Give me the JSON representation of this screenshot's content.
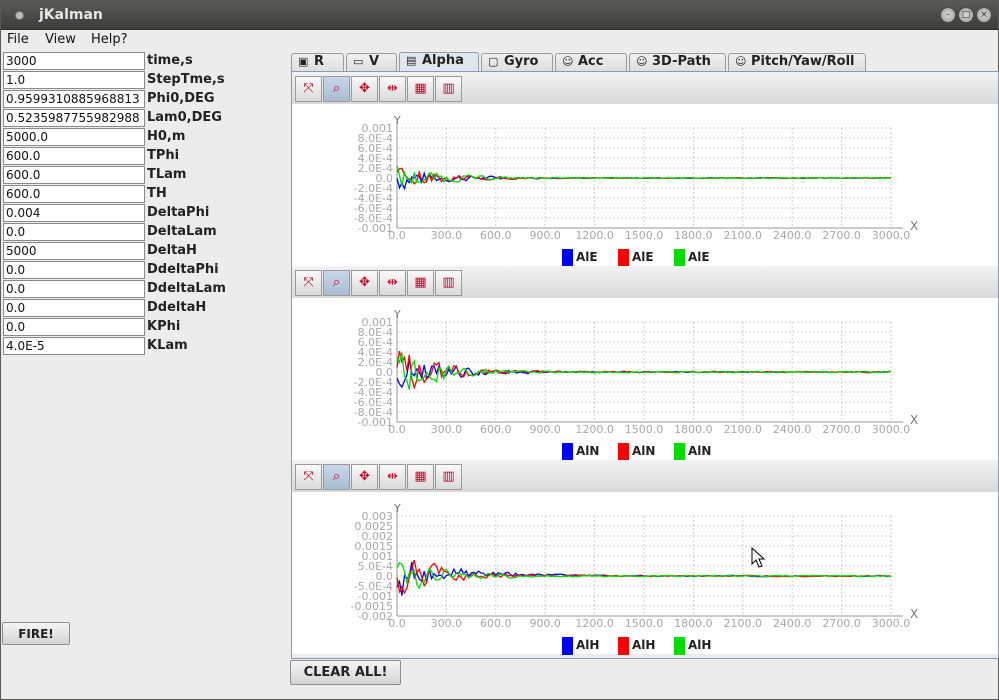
{
  "window": {
    "title": "jKalman"
  },
  "menu": [
    "File",
    "View",
    "Help?"
  ],
  "fields": [
    {
      "value": "3000",
      "label": "time,s"
    },
    {
      "value": "1.0",
      "label": "StepTme,s"
    },
    {
      "value": "0.9599310885968813",
      "label": "Phi0,DEG"
    },
    {
      "value": "0.5235987755982988",
      "label": "Lam0,DEG"
    },
    {
      "value": "5000.0",
      "label": "H0,m"
    },
    {
      "value": "600.0",
      "label": "TPhi"
    },
    {
      "value": "600.0",
      "label": "TLam"
    },
    {
      "value": "600.0",
      "label": "TH"
    },
    {
      "value": "0.004",
      "label": "DeltaPhi"
    },
    {
      "value": "0.0",
      "label": "DeltaLam"
    },
    {
      "value": "5000",
      "label": "DeltaH"
    },
    {
      "value": "0.0",
      "label": "DdeltaPhi"
    },
    {
      "value": "0.0",
      "label": "DdeltaLam"
    },
    {
      "value": "0.0",
      "label": "DdeltaH"
    },
    {
      "value": "0.0",
      "label": "KPhi"
    },
    {
      "value": "4.0E-5",
      "label": "KLam"
    }
  ],
  "buttons": {
    "fire": "FIRE!",
    "clear": "CLEAR ALL!"
  },
  "tabs": [
    {
      "label": "R",
      "icon": "monitor-icon"
    },
    {
      "label": "V",
      "icon": "folder-icon"
    },
    {
      "label": "Alpha",
      "icon": "document-icon",
      "active": true
    },
    {
      "label": "Gyro",
      "icon": "page-icon"
    },
    {
      "label": "Acc",
      "icon": "smiley-icon"
    },
    {
      "label": "3D-Path",
      "icon": "smiley-icon"
    },
    {
      "label": "Pitch/Yaw/Roll",
      "icon": "smiley-icon"
    }
  ],
  "toolbar_icons": [
    "zoom-reset-icon",
    "zoom-icon",
    "pan-icon",
    "fit-icon",
    "save-icon",
    "grid-icon"
  ],
  "colors": {
    "blue": "#0000ff",
    "red": "#ff0000",
    "green": "#00dd00"
  },
  "chart_data": [
    {
      "type": "line",
      "xlabel": "X",
      "ylabel": "Y",
      "xlim": [
        0,
        3000
      ],
      "ylim": [
        -0.001,
        0.001
      ],
      "x_ticks": [
        "0.0",
        "300.0",
        "600.0",
        "900.0",
        "1200.0",
        "1500.0",
        "1800.0",
        "2100.0",
        "2400.0",
        "2700.0",
        "3000.0"
      ],
      "y_ticks": [
        "0.001",
        "8.0E-4",
        "6.0E-4",
        "4.0E-4",
        "2.0E-4",
        "0.0",
        "-2.0E-4",
        "-4.0E-4",
        "-6.0E-4",
        "-8.0E-4",
        "-0.001"
      ],
      "series": [
        {
          "name": "AlE",
          "color": "#0000ff"
        },
        {
          "name": "AlE",
          "color": "#ff0000"
        },
        {
          "name": "AlE",
          "color": "#00dd00"
        }
      ],
      "amplitude": 0.0004
    },
    {
      "type": "line",
      "xlabel": "X",
      "ylabel": "Y",
      "xlim": [
        0,
        3000
      ],
      "ylim": [
        -0.001,
        0.001
      ],
      "x_ticks": [
        "0.0",
        "300.0",
        "600.0",
        "900.0",
        "1200.0",
        "1500.0",
        "1800.0",
        "2100.0",
        "2400.0",
        "2700.0",
        "3000.0"
      ],
      "y_ticks": [
        "0.001",
        "8.0E-4",
        "6.0E-4",
        "4.0E-4",
        "2.0E-4",
        "0.0",
        "-2.0E-4",
        "-4.0E-4",
        "-6.0E-4",
        "-8.0E-4",
        "-0.001"
      ],
      "series": [
        {
          "name": "AlN",
          "color": "#0000ff"
        },
        {
          "name": "AlN",
          "color": "#ff0000"
        },
        {
          "name": "AlN",
          "color": "#00dd00"
        }
      ],
      "amplitude": 0.0007
    },
    {
      "type": "line",
      "xlabel": "X",
      "ylabel": "Y",
      "xlim": [
        0,
        3000
      ],
      "ylim": [
        -0.002,
        0.003
      ],
      "x_ticks": [
        "0.0",
        "300.0",
        "600.0",
        "900.0",
        "1200.0",
        "1500.0",
        "1800.0",
        "2100.0",
        "2400.0",
        "2700.0",
        "3000.0"
      ],
      "y_ticks": [
        "0.003",
        "0.0025",
        "0.002",
        "0.0015",
        "0.001",
        "5.0E-4",
        "0.0",
        "-5.0E-4",
        "-0.001",
        "-0.0015",
        "-0.002"
      ],
      "series": [
        {
          "name": "AlH",
          "color": "#0000ff"
        },
        {
          "name": "AlH",
          "color": "#ff0000"
        },
        {
          "name": "AlH",
          "color": "#00dd00"
        }
      ],
      "amplitude": 0.0016
    }
  ]
}
